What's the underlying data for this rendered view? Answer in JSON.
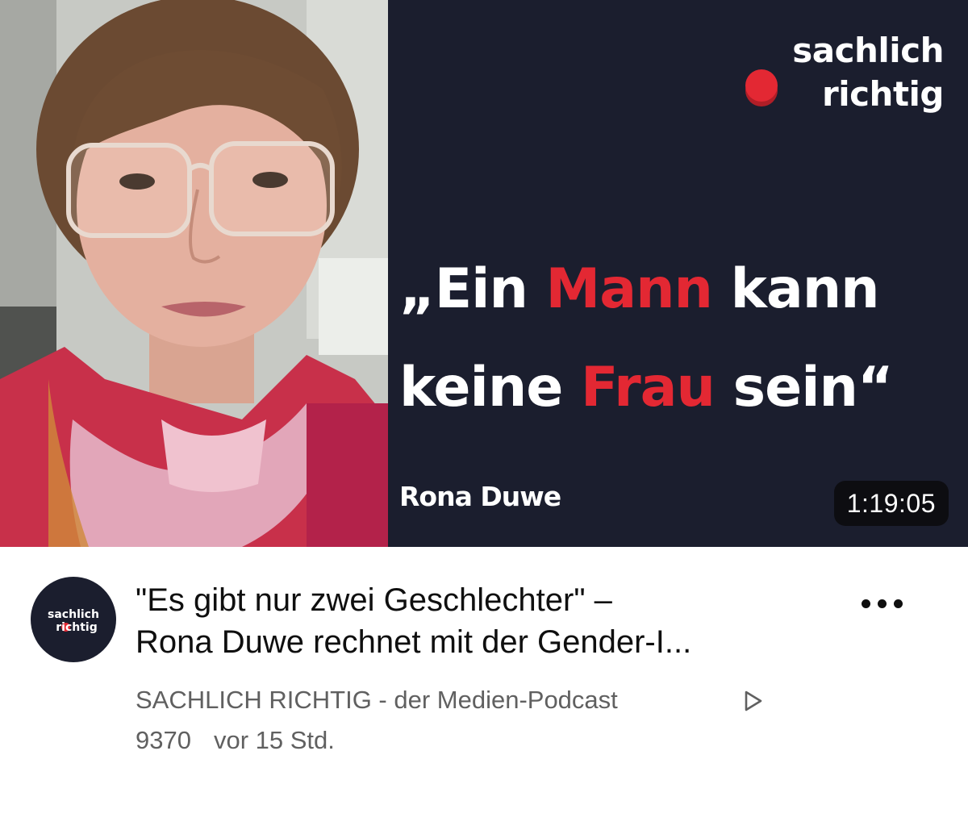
{
  "thumbnail": {
    "brand": {
      "line1": "sachlich",
      "line2": "richtig"
    },
    "quote": {
      "line1": {
        "a": "„Ein ",
        "b": "Mann",
        "c": " kann"
      },
      "line2": {
        "a": "keine ",
        "b": "Frau",
        "c": " sein“"
      }
    },
    "speaker": "Rona Duwe",
    "duration": "1:19:05"
  },
  "video": {
    "title_line1": "\"Es gibt nur zwei Geschlechter\" –",
    "title_line2": "Rona Duwe rechnet mit der Gender-I...",
    "channel": "SACHLICH RICHTIG - der Medien-Podcast",
    "views": "9370",
    "age": "vor 15 Std."
  },
  "avatar": {
    "line1": "sachlich",
    "line2": "richtig"
  },
  "colors": {
    "panel_bg": "#1b1e2e",
    "accent_red": "#e32833",
    "meta_gray": "#606060",
    "title_black": "#0f0f0f"
  },
  "icons": {
    "more": "more-horizontal-icon",
    "play": "play-outline-icon",
    "brand": "red-dot-logo"
  }
}
